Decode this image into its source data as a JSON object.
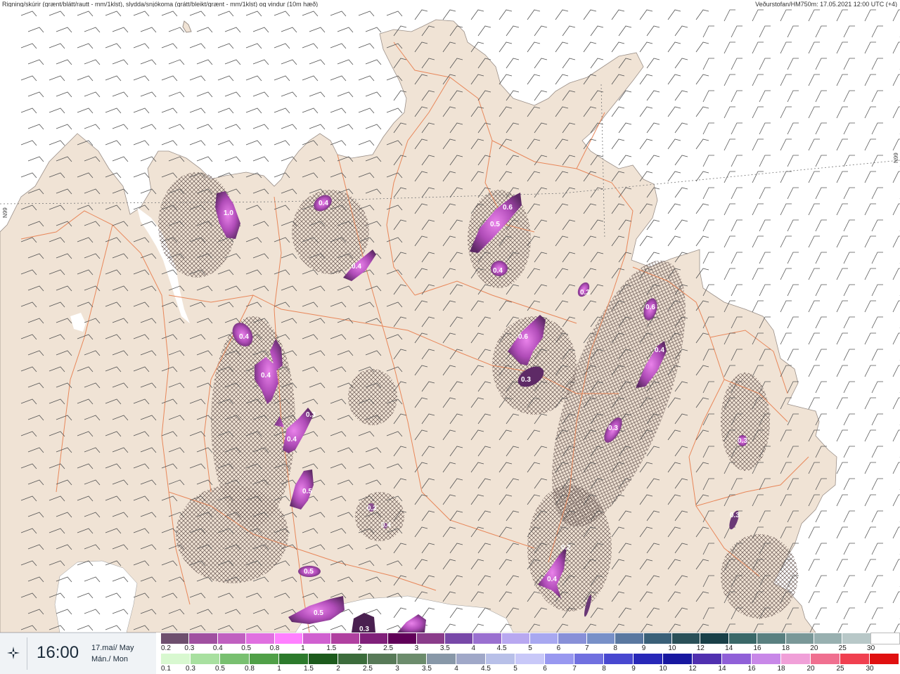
{
  "header": {
    "title_left": "Rigning/skúrir (grænt/blátt/rautt - mm/1klst), slydda/snjókoma (grátt/bleikt/grænt - mm/1klst) og vindur (10m hæð)",
    "title_right": "Veðurstofan/HM750m: 17.05.2021 12:00 UTC (+4)"
  },
  "graticule": {
    "left_label": "N99",
    "right_label": "N99"
  },
  "time": {
    "icon": "clock-icon",
    "value": "16:00",
    "date_line1": "17.maí/ May",
    "date_line2": "Mán./ Mon"
  },
  "legend_sleet": {
    "labels": [
      "0.2",
      "0.3",
      "0.4",
      "0.5",
      "0.8",
      "1",
      "1.5",
      "2",
      "2.5",
      "3",
      "3.5",
      "4",
      "4.5",
      "5",
      "6",
      "7",
      "8",
      "9",
      "10",
      "12",
      "14",
      "16",
      "18",
      "20",
      "25",
      "30"
    ],
    "colors": [
      "#6e4f6e",
      "#a050a0",
      "#c060c0",
      "#e070e0",
      "#ff80ff",
      "#d060d0",
      "#b040a0",
      "#80207a",
      "#600058",
      "#8a3c8a",
      "#7848a8",
      "#9a70d0",
      "#b8a8f0",
      "#a8a8f0",
      "#8890d8",
      "#7890c8",
      "#5a78a0",
      "#3a6078",
      "#2a5058",
      "#1a4048",
      "#3a6868",
      "#5a8080",
      "#7a9898",
      "#98b0b0",
      "#b8c8c8",
      "#ffffff"
    ]
  },
  "legend_rain": {
    "labels": [
      "0.1",
      "0.3",
      "0.5",
      "0.8",
      "1",
      "1.5",
      "2",
      "2.5",
      "3",
      "3.5",
      "4",
      "4.5",
      "5",
      "6",
      "7",
      "8",
      "9",
      "10",
      "12",
      "14",
      "16",
      "18",
      "20",
      "25",
      "30"
    ],
    "colors": [
      "#d8f8d0",
      "#a8e0a0",
      "#78c070",
      "#50a048",
      "#2c7a2c",
      "#1c5a1c",
      "#3c6c3c",
      "#587a58",
      "#6c8c6c",
      "#8898a8",
      "#a0a8c8",
      "#b8c0e8",
      "#c8c8f8",
      "#9898f0",
      "#7070e0",
      "#4848d0",
      "#2828b8",
      "#1818a0",
      "#5030b0",
      "#9060d8",
      "#c888e8",
      "#f0a0d8",
      "#f07090",
      "#f04050",
      "#e01010"
    ]
  },
  "map": {
    "land_color": "#f0e3d5",
    "sea_color": "#ffffff",
    "ice_color": "#ffffff",
    "road_color": "#e8875a",
    "cells": [
      {
        "label": "1.0"
      },
      {
        "label": "0.4"
      },
      {
        "label": "0.4"
      },
      {
        "label": "0.4"
      },
      {
        "label": "0.4"
      },
      {
        "label": "0.3"
      },
      {
        "label": "0.4"
      },
      {
        "label": "0.5"
      },
      {
        "label": "0.5"
      },
      {
        "label": "0.5"
      },
      {
        "label": "0.3"
      },
      {
        "label": "0.6"
      },
      {
        "label": "0.5"
      },
      {
        "label": "0.4"
      },
      {
        "label": "0.3"
      },
      {
        "label": "0.6"
      },
      {
        "label": "0.3"
      },
      {
        "label": "0.6"
      },
      {
        "label": "0.4"
      },
      {
        "label": "0.3"
      },
      {
        "label": "0.4"
      },
      {
        "label": "0.2"
      },
      {
        "label": "0.3"
      },
      {
        "label": "0.3"
      },
      {
        "label": "0.2"
      },
      {
        "label": "0.4"
      }
    ]
  }
}
